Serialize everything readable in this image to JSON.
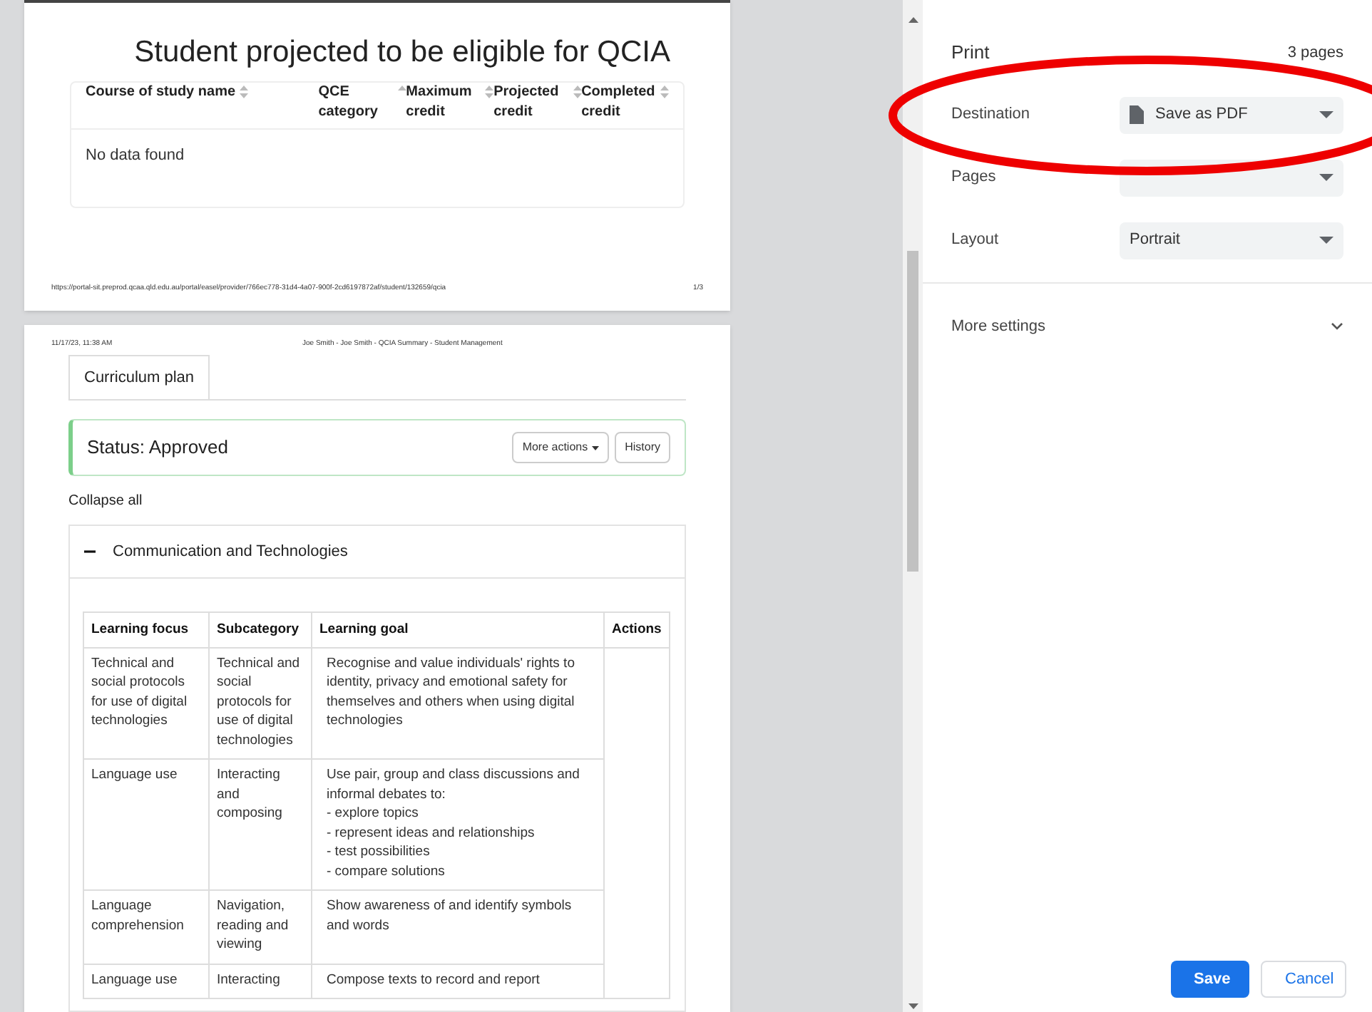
{
  "preview": {
    "page_1": {
      "heading": "Student projected to be eligible for QCIA",
      "columns": [
        {
          "label": "Course of study name",
          "sorted": false
        },
        {
          "label": "QCE category",
          "sorted": true
        },
        {
          "label": "Maximum credit",
          "sorted": false
        },
        {
          "label": "Projected credit",
          "sorted": false
        },
        {
          "label": "Completed credit",
          "sorted": false
        }
      ],
      "empty_message": "No data found",
      "footer_url": "https://portal-sit.preprod.qcaa.qld.edu.au/portal/easel/provider/766ec778-31d4-4a07-900f-2cd6197872af/student/132659/qcia",
      "footer_page": "1/3"
    },
    "page_2": {
      "header_date": "11/17/23, 11:38 AM",
      "header_title": "Joe Smith - Joe Smith - QCIA Summary - Student Management",
      "tab": "Curriculum plan",
      "status": "Status: Approved",
      "buttons": [
        "More actions",
        "History"
      ],
      "collapse_all": "Collapse all",
      "section": {
        "title": "Communication and Technologies",
        "expanded": true
      },
      "columns": [
        "Learning focus",
        "Subcategory",
        "Learning goal",
        "Actions"
      ],
      "rows": [
        {
          "focus": "Technical and social protocols for use of digital technologies",
          "subcategory": "Technical and social protocols for use of digital technologies",
          "goal": "Recognise and value individuals' rights to identity, privacy and emotional safety for themselves and others when using digital technologies"
        },
        {
          "focus": "Language use",
          "subcategory": "Interacting and composing",
          "goal": "Use pair, group and class discussions and informal debates to:\n- explore topics\n- represent ideas and relationships\n- test possibilities\n- compare solutions"
        },
        {
          "focus": "Language comprehension",
          "subcategory": "Navigation, reading and viewing",
          "goal": "Show awareness of and identify symbols and words"
        },
        {
          "focus": "Language use",
          "subcategory": "Interacting",
          "goal": "Compose texts to record and report"
        }
      ]
    }
  },
  "print_panel": {
    "title": "Print",
    "page_count": "3 pages",
    "settings": [
      {
        "label": "Destination",
        "value": "Save as PDF",
        "kind": "file"
      },
      {
        "label": "Pages",
        "kind": "hidden"
      },
      {
        "label": "Layout",
        "value": "Portrait",
        "kind": "plain"
      }
    ],
    "more_settings": {
      "label": "More settings",
      "expanded": false
    },
    "buttons": [
      {
        "label": "Save",
        "kind": "primary"
      },
      {
        "label": "Cancel",
        "kind": "secondary"
      }
    ]
  }
}
